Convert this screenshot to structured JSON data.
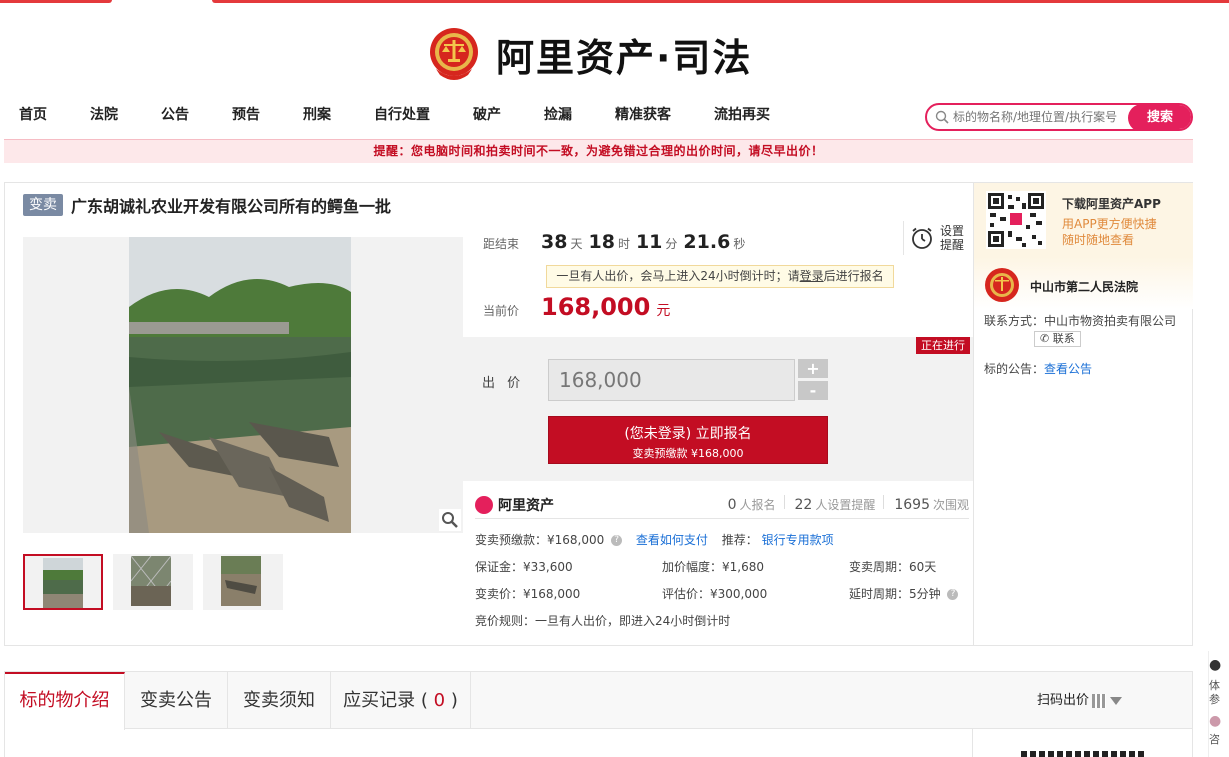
{
  "logo": {
    "text": "阿里资产·司法"
  },
  "nav": {
    "items": [
      "首页",
      "法院",
      "公告",
      "预告",
      "刑案",
      "自行处置",
      "破产",
      "捡漏",
      "精准获客",
      "流拍再买"
    ],
    "search_placeholder": "标的物名称/地理位置/执行案号",
    "search_button": "搜索"
  },
  "notice": "提醒：您电脑时间和拍卖时间不一致，为避免错过合理的出价时间，请尽早出价！",
  "item": {
    "tag": "变卖",
    "title": "广东胡诚礼农业开发有限公司所有的鳄鱼一批"
  },
  "countdown": {
    "label": "距结束",
    "days": "38",
    "days_unit": "天",
    "hours": "18",
    "hours_unit": "时",
    "minutes": "11",
    "minutes_unit": "分",
    "seconds": "21.6",
    "seconds_unit": "秒"
  },
  "remind": {
    "label": "设置提醒"
  },
  "tip": {
    "pre": "一旦有人出价，会马上进入24小时倒计时；请",
    "link": "登录",
    "post": "后进行报名"
  },
  "price": {
    "label": "当前价",
    "value": "168,000",
    "unit": "元"
  },
  "bid": {
    "status": "正在进行",
    "label": "出 价",
    "value": "168,000",
    "plus": "+",
    "minus": "-",
    "signup_line1": "(您未登录) 立即报名",
    "signup_line2": "变卖预缴款 ¥168,000"
  },
  "stats": {
    "brand": "阿里资产",
    "signups": "0",
    "signups_label": "人报名",
    "reminders": "22",
    "reminders_label": "人设置提醒",
    "views": "1695",
    "views_label": "次围观"
  },
  "details": {
    "deposit_pre": "变卖预缴款：¥168,000",
    "how_to_pay": "查看如何支付",
    "recommend": "推荐：",
    "bank": "银行专用款项",
    "guarantee": "保证金：¥33,600",
    "increment": "加价幅度：¥1,680",
    "period": "变卖周期：60天",
    "sale_price": "变卖价：¥168,000",
    "appraisal": "评估价：¥300,000",
    "delay": "延时周期：5分钟",
    "rule": "竞价规则：一旦有人出价，即进入24小时倒计时"
  },
  "app": {
    "title": "下载阿里资产APP",
    "sub1": "用APP更方便快捷",
    "sub2": "随时随地查看"
  },
  "court": {
    "name": "中山市第二人民法院",
    "contact_label": "联系方式：中山市物资拍卖有限公司",
    "contact_button": "联系",
    "announce_label": "标的公告：",
    "announce_link": "查看公告"
  },
  "tabs": {
    "items": [
      "标的物介绍",
      "变卖公告",
      "变卖须知"
    ],
    "records_label": "应买记录",
    "records_open": "(",
    "records_count": "0",
    "records_close": ")",
    "scan_bid": "扫码出价"
  },
  "float": {
    "line1": "体",
    "line2": "参",
    "line3": "咨"
  },
  "colors": {
    "accent": "#c30d23",
    "brand_pink": "#e4205c",
    "link": "#1a6fd6"
  }
}
